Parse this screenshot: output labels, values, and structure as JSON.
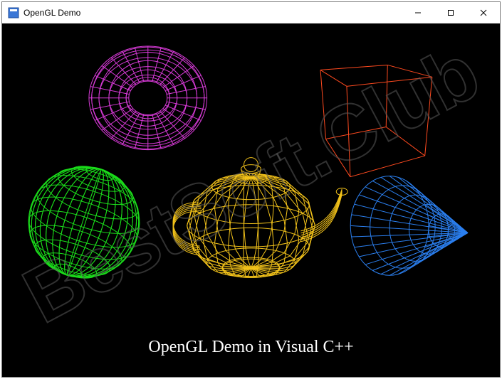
{
  "window": {
    "title": "OpenGL Demo",
    "controls": {
      "minimize_glyph": "—",
      "maximize_glyph": "☐",
      "close_glyph": "✕"
    }
  },
  "scene": {
    "caption": "OpenGL Demo in Visual C++",
    "objects": {
      "torus": {
        "color": "#d63ad6",
        "shape": "wire-torus"
      },
      "cube": {
        "color": "#ff4a1f",
        "shape": "wire-cube"
      },
      "sphere": {
        "color": "#1bdc1b",
        "shape": "wire-sphere"
      },
      "teapot": {
        "color": "#f2c21a",
        "shape": "wire-teapot"
      },
      "cone": {
        "color": "#2b7fef",
        "shape": "wire-cone"
      }
    }
  },
  "watermark": {
    "text": "BestSoft.Club"
  }
}
